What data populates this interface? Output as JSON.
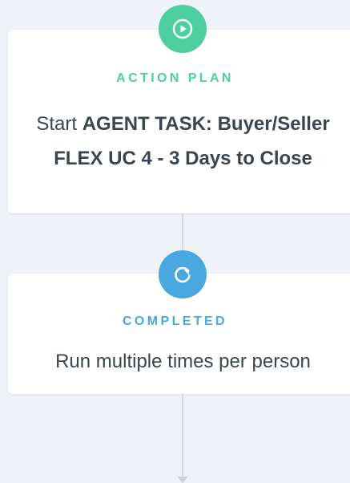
{
  "steps": [
    {
      "type_label": "ACTION PLAN",
      "icon": "play-circle-icon",
      "accent": "#4dcfa1",
      "description_prefix": "Start",
      "description_strong": "AGENT TASK: Buyer/Seller FLEX UC 4 - 3 Days to Close"
    },
    {
      "type_label": "COMPLETED",
      "icon": "refresh-icon",
      "accent": "#4aa8e0",
      "description": "Run multiple times per person"
    }
  ],
  "colors": {
    "background": "#eff2f7",
    "card": "#ffffff",
    "text": "#3b4453",
    "connector": "#d5dae3"
  }
}
